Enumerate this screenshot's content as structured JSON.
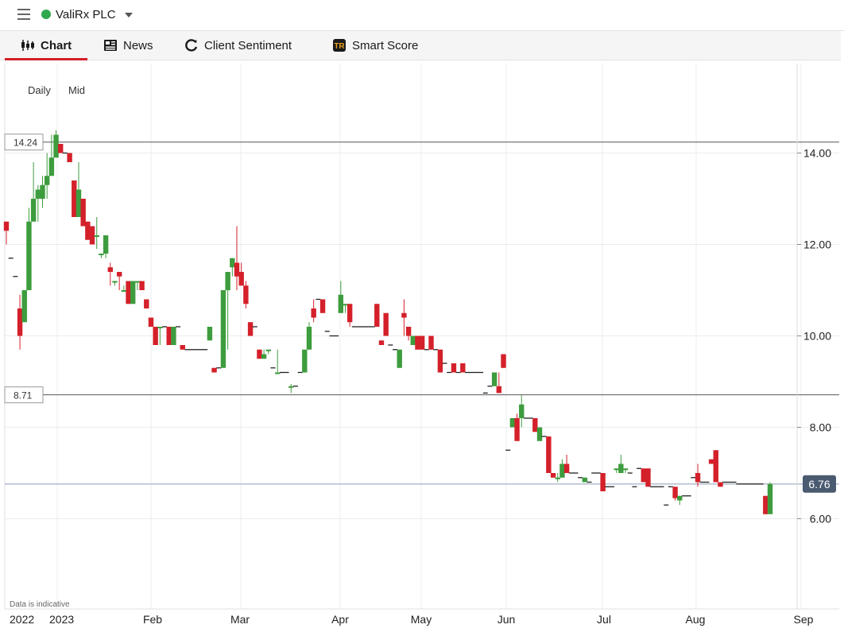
{
  "header": {
    "instrument": "ValiRx PLC"
  },
  "tabs": [
    {
      "label": "Chart",
      "icon": "candlestick-icon"
    },
    {
      "label": "News",
      "icon": "newspaper-icon"
    },
    {
      "label": "Client Sentiment",
      "icon": "sentiment-icon"
    },
    {
      "label": "Smart Score",
      "icon": "smart-score-icon"
    }
  ],
  "chart_controls": {
    "interval": "Daily",
    "price_type": "Mid"
  },
  "disclaimer": "Data is indicative",
  "colors": {
    "up": "#3d9c3d",
    "down": "#d4202a",
    "accent": "#d4202a",
    "price_marker": "#4a5a70"
  },
  "chart_data": {
    "type": "candlestick",
    "y_ticks": [
      "14.00",
      "12.00",
      "10.00",
      "8.00",
      "6.00"
    ],
    "ylim": [
      4.4,
      15.5
    ],
    "x_labels": [
      "2022",
      "2023",
      "Feb",
      "Mar",
      "Apr",
      "May",
      "Jun",
      "Jul",
      "Aug",
      "Sep"
    ],
    "reference_lines": [
      {
        "label": "14.24",
        "value": 14.24
      },
      {
        "label": "8.71",
        "value": 8.71
      }
    ],
    "last_price": {
      "label": "6.76",
      "value": 6.76
    },
    "grid": true,
    "candles": [
      [
        12.5,
        12.5,
        12.0,
        12.3
      ],
      [
        11.7,
        11.7,
        11.7,
        11.7
      ],
      [
        11.3,
        11.3,
        11.3,
        11.3
      ],
      [
        10.6,
        10.9,
        9.7,
        10.0
      ],
      [
        10.3,
        11.0,
        10.3,
        11.0
      ],
      [
        11.0,
        12.8,
        11.0,
        12.5
      ],
      [
        12.5,
        13.8,
        12.5,
        13.0
      ],
      [
        13.0,
        13.3,
        12.5,
        13.2
      ],
      [
        13.0,
        13.5,
        12.8,
        13.3
      ],
      [
        13.3,
        14.0,
        13.0,
        13.5
      ],
      [
        13.5,
        14.4,
        13.5,
        13.9
      ],
      [
        13.9,
        14.5,
        13.9,
        14.4
      ],
      [
        14.2,
        14.2,
        14.0,
        14.0
      ],
      [
        14.0,
        14.0,
        14.0,
        14.0
      ],
      [
        14.0,
        14.0,
        13.8,
        13.8
      ],
      [
        13.4,
        13.4,
        12.6,
        12.6
      ],
      [
        12.6,
        13.8,
        12.6,
        13.2
      ],
      [
        13.0,
        13.0,
        12.4,
        12.4
      ],
      [
        12.5,
        12.5,
        12.1,
        12.1
      ],
      [
        12.4,
        12.4,
        12.0,
        12.0
      ],
      [
        12.2,
        12.6,
        11.9,
        12.2
      ],
      [
        11.8,
        11.8,
        11.7,
        11.8
      ],
      [
        11.8,
        12.2,
        11.7,
        12.2
      ],
      [
        11.5,
        11.6,
        11.1,
        11.4
      ],
      [
        11.2,
        11.2,
        11.1,
        11.2
      ],
      [
        11.4,
        11.4,
        11.0,
        11.3
      ],
      [
        11.0,
        11.1,
        11.0,
        11.0
      ],
      [
        11.2,
        11.2,
        10.7,
        10.7
      ],
      [
        10.7,
        11.2,
        10.7,
        11.2
      ],
      [
        11.2,
        11.2,
        11.0,
        11.2
      ],
      [
        11.2,
        11.2,
        11.0,
        11.0
      ],
      [
        10.8,
        10.8,
        10.6,
        10.6
      ],
      [
        10.4,
        10.4,
        10.2,
        10.2
      ],
      [
        10.2,
        10.2,
        9.8,
        9.8
      ],
      [
        10.2,
        10.2,
        9.8,
        10.2
      ],
      [
        10.2,
        10.2,
        10.2,
        10.2
      ],
      [
        10.2,
        10.2,
        9.8,
        9.8
      ],
      [
        9.8,
        10.2,
        9.8,
        10.2
      ],
      [
        10.2,
        10.2,
        10.2,
        10.2
      ],
      [
        9.8,
        9.8,
        9.7,
        9.7
      ],
      [
        9.7,
        9.7,
        9.7,
        9.7
      ],
      [
        9.7,
        9.7,
        9.7,
        9.7
      ],
      [
        9.7,
        9.7,
        9.7,
        9.7
      ],
      [
        9.7,
        9.7,
        9.7,
        9.7
      ],
      [
        9.7,
        9.7,
        9.7,
        9.7
      ],
      [
        9.9,
        10.2,
        9.9,
        10.2
      ],
      [
        9.3,
        9.3,
        9.2,
        9.2
      ],
      [
        9.3,
        9.3,
        9.3,
        9.3
      ],
      [
        9.3,
        11.0,
        9.3,
        11.0
      ],
      [
        11.0,
        11.4,
        9.7,
        11.4
      ],
      [
        11.5,
        11.7,
        11.3,
        11.7
      ],
      [
        11.6,
        12.4,
        11.0,
        11.3
      ],
      [
        11.4,
        11.6,
        11.1,
        11.1
      ],
      [
        11.1,
        11.2,
        10.6,
        10.7
      ],
      [
        10.3,
        10.3,
        10.0,
        10.0
      ],
      [
        10.2,
        10.2,
        10.2,
        10.2
      ],
      [
        9.7,
        9.7,
        9.5,
        9.5
      ],
      [
        9.5,
        9.7,
        9.5,
        9.6
      ],
      [
        9.7,
        9.7,
        9.6,
        9.7
      ],
      [
        9.3,
        9.3,
        9.3,
        9.3
      ],
      [
        9.2,
        9.7,
        9.2,
        9.2
      ],
      [
        9.2,
        9.2,
        9.2,
        9.2
      ],
      [
        9.2,
        9.2,
        9.2,
        9.2
      ],
      [
        8.9,
        8.95,
        8.75,
        8.9
      ],
      [
        8.9,
        8.9,
        8.9,
        8.9
      ],
      [
        9.2,
        9.2,
        9.2,
        9.2
      ],
      [
        9.2,
        9.7,
        9.2,
        9.7
      ],
      [
        9.7,
        10.3,
        9.7,
        10.2
      ],
      [
        10.6,
        10.8,
        10.3,
        10.4
      ],
      [
        10.8,
        10.8,
        10.8,
        10.8
      ],
      [
        10.8,
        10.8,
        10.5,
        10.5
      ],
      [
        10.1,
        10.1,
        10.1,
        10.1
      ],
      [
        10.0,
        10.0,
        10.0,
        10.0
      ],
      [
        10.0,
        10.0,
        10.0,
        10.0
      ],
      [
        10.5,
        11.2,
        10.5,
        10.9
      ],
      [
        10.7,
        10.7,
        10.5,
        10.7
      ],
      [
        10.7,
        10.7,
        10.2,
        10.3
      ],
      [
        10.2,
        10.2,
        10.2,
        10.2
      ],
      [
        10.2,
        10.2,
        10.2,
        10.2
      ],
      [
        10.2,
        10.2,
        10.2,
        10.2
      ],
      [
        10.2,
        10.2,
        10.2,
        10.2
      ],
      [
        10.2,
        10.2,
        10.2,
        10.2
      ],
      [
        10.7,
        10.7,
        10.2,
        10.2
      ],
      [
        9.9,
        9.9,
        9.8,
        9.8
      ],
      [
        10.5,
        10.5,
        10.0,
        10.0
      ],
      [
        9.8,
        9.8,
        9.8,
        9.8
      ],
      [
        9.7,
        9.7,
        9.7,
        9.7
      ],
      [
        9.3,
        9.7,
        9.3,
        9.7
      ],
      [
        10.5,
        10.8,
        10.0,
        10.4
      ],
      [
        10.2,
        10.2,
        9.9,
        10.0
      ],
      [
        9.8,
        10.0,
        9.8,
        10.0
      ],
      [
        10.0,
        10.0,
        9.7,
        9.7
      ],
      [
        10.0,
        10.0,
        9.7,
        9.7
      ],
      [
        9.7,
        9.7,
        9.7,
        9.7
      ],
      [
        10.0,
        10.0,
        9.7,
        9.7
      ],
      [
        9.7,
        9.7,
        9.7,
        9.7
      ],
      [
        9.7,
        9.7,
        9.2,
        9.2
      ],
      [
        9.4,
        9.4,
        9.4,
        9.4
      ],
      [
        9.2,
        9.2,
        9.2,
        9.2
      ],
      [
        9.4,
        9.4,
        9.2,
        9.2
      ],
      [
        9.2,
        9.2,
        9.2,
        9.2
      ],
      [
        9.4,
        9.4,
        9.2,
        9.2
      ],
      [
        9.2,
        9.2,
        9.2,
        9.2
      ],
      [
        9.2,
        9.2,
        9.2,
        9.2
      ],
      [
        9.2,
        9.2,
        9.2,
        9.2
      ],
      [
        9.2,
        9.2,
        9.2,
        9.2
      ],
      [
        8.75,
        8.75,
        8.75,
        8.75
      ],
      [
        8.9,
        8.9,
        8.9,
        8.9
      ],
      [
        8.9,
        9.2,
        8.9,
        9.2
      ],
      [
        8.9,
        9.2,
        8.75,
        8.75
      ],
      [
        9.6,
        9.6,
        9.3,
        9.3
      ],
      [
        7.5,
        7.5,
        7.5,
        7.5
      ],
      [
        8.0,
        8.2,
        8.0,
        8.2
      ],
      [
        8.2,
        8.3,
        7.7,
        7.7
      ],
      [
        8.2,
        8.7,
        8.0,
        8.5
      ],
      [
        8.2,
        8.2,
        8.2,
        8.2
      ],
      [
        8.2,
        8.2,
        8.2,
        8.2
      ],
      [
        8.2,
        8.2,
        7.9,
        7.9
      ],
      [
        7.7,
        8.0,
        7.7,
        8.0
      ],
      [
        7.8,
        7.8,
        7.8,
        7.8
      ],
      [
        7.8,
        7.8,
        7.0,
        7.0
      ],
      [
        7.0,
        7.0,
        6.9,
        6.9
      ],
      [
        6.9,
        7.0,
        6.8,
        6.9
      ],
      [
        6.9,
        7.3,
        6.9,
        7.2
      ],
      [
        7.2,
        7.4,
        7.0,
        7.0
      ],
      [
        7.0,
        7.0,
        7.0,
        7.0
      ],
      [
        7.0,
        7.0,
        7.0,
        7.0
      ],
      [
        6.9,
        6.9,
        6.9,
        6.9
      ],
      [
        6.8,
        6.9,
        6.8,
        6.9
      ],
      [
        6.8,
        6.8,
        6.8,
        6.8
      ],
      [
        7.0,
        7.0,
        7.0,
        7.0
      ],
      [
        7.0,
        7.0,
        7.0,
        7.0
      ],
      [
        7.0,
        7.0,
        6.6,
        6.6
      ],
      [
        6.7,
        6.7,
        6.7,
        6.7
      ],
      [
        6.7,
        6.7,
        6.7,
        6.7
      ],
      [
        7.1,
        7.1,
        7.0,
        7.1
      ],
      [
        7.0,
        7.4,
        7.0,
        7.2
      ],
      [
        7.1,
        7.1,
        7.0,
        7.1
      ],
      [
        7.0,
        7.0,
        7.0,
        7.0
      ],
      [
        6.7,
        6.7,
        6.7,
        6.7
      ],
      [
        7.1,
        7.1,
        7.1,
        7.1
      ],
      [
        7.1,
        7.1,
        6.8,
        6.8
      ],
      [
        7.1,
        7.1,
        6.7,
        6.7
      ],
      [
        6.7,
        6.7,
        6.7,
        6.7
      ],
      [
        6.7,
        6.7,
        6.7,
        6.7
      ],
      [
        6.7,
        6.7,
        6.7,
        6.7
      ],
      [
        6.3,
        6.3,
        6.3,
        6.3
      ],
      [
        6.7,
        6.7,
        6.7,
        6.7
      ],
      [
        6.7,
        6.7,
        6.4,
        6.45
      ],
      [
        6.4,
        6.5,
        6.3,
        6.5
      ],
      [
        6.5,
        6.5,
        6.5,
        6.5
      ],
      [
        6.5,
        6.5,
        6.5,
        6.5
      ],
      [
        6.9,
        6.9,
        6.9,
        6.9
      ],
      [
        7.0,
        7.2,
        6.7,
        6.8
      ],
      [
        6.8,
        6.8,
        6.8,
        6.8
      ],
      [
        6.8,
        6.8,
        6.8,
        6.8
      ],
      [
        7.3,
        7.3,
        7.2,
        7.2
      ],
      [
        7.5,
        7.5,
        6.8,
        6.8
      ],
      [
        6.8,
        6.8,
        6.7,
        6.7
      ],
      [
        6.8,
        6.8,
        6.8,
        6.8
      ],
      [
        6.8,
        6.8,
        6.8,
        6.8
      ],
      [
        6.8,
        6.8,
        6.8,
        6.8
      ],
      [
        6.76,
        6.76,
        6.76,
        6.76
      ],
      [
        6.76,
        6.76,
        6.76,
        6.76
      ],
      [
        6.76,
        6.76,
        6.76,
        6.76
      ],
      [
        6.76,
        6.76,
        6.76,
        6.76
      ],
      [
        6.76,
        6.76,
        6.76,
        6.76
      ],
      [
        6.76,
        6.76,
        6.76,
        6.76
      ],
      [
        6.5,
        6.5,
        6.1,
        6.1
      ],
      [
        6.1,
        6.8,
        6.1,
        6.76
      ]
    ]
  }
}
